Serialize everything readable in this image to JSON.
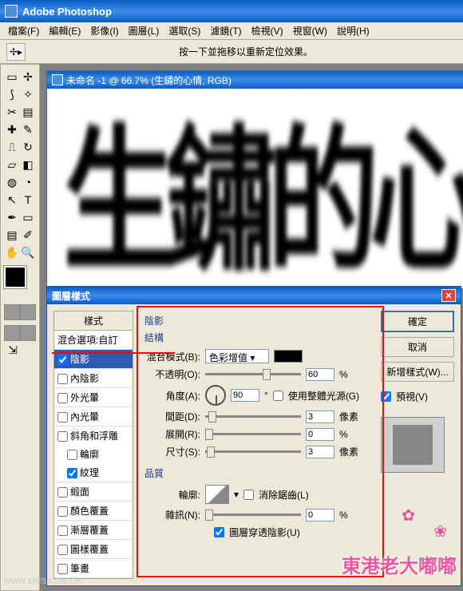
{
  "app": {
    "title": "Adobe Photoshop"
  },
  "menu": [
    "檔案(F)",
    "編輯(E)",
    "影像(I)",
    "圖層(L)",
    "選取(S)",
    "濾鏡(T)",
    "檢視(V)",
    "視窗(W)",
    "說明(H)"
  ],
  "optbar": {
    "hint": "按一下並拖移以重新定位效果。"
  },
  "doc": {
    "title": "未命名 -1 @ 66.7% (生鏽的心情, RGB)"
  },
  "canvas_text": "生鏽的心情",
  "dialog": {
    "title": "圖層樣式",
    "styles_header": "樣式",
    "blend_opts": "混合選項:自訂",
    "list": [
      {
        "label": "陰影",
        "checked": true,
        "selected": true
      },
      {
        "label": "內陰影",
        "checked": false
      },
      {
        "label": "外光暈",
        "checked": false
      },
      {
        "label": "內光暈",
        "checked": false
      },
      {
        "label": "斜角和浮雕",
        "checked": false
      },
      {
        "label": "輪廓",
        "checked": false,
        "indent": true
      },
      {
        "label": "紋理",
        "checked": true,
        "indent": true
      },
      {
        "label": "緞面",
        "checked": false
      },
      {
        "label": "顏色覆蓋",
        "checked": false
      },
      {
        "label": "漸層覆蓋",
        "checked": false
      },
      {
        "label": "圖樣覆蓋",
        "checked": false
      },
      {
        "label": "筆畫",
        "checked": false
      }
    ],
    "section": "陰影",
    "group_struct": "結構",
    "blend_label": "混合模式(B):",
    "blend_value": "色彩增值",
    "opacity_label": "不透明(O):",
    "opacity_value": "60",
    "angle_label": "角度(A):",
    "angle_value": "90",
    "angle_unit": "°",
    "global_light": "使用整體光源(G)",
    "distance_label": "間距(D):",
    "distance_value": "3",
    "spread_label": "展開(R):",
    "spread_value": "0",
    "size_label": "尺寸(S):",
    "size_value": "3",
    "px": "像素",
    "pct": "%",
    "group_quality": "品質",
    "contour_label": "輪廓:",
    "antialias": "消除鋸齒(L)",
    "noise_label": "雜訊(N):",
    "noise_value": "0",
    "knockout": "圖層穿透陰影(U)",
    "ok": "確定",
    "cancel": "取消",
    "new_style": "新增樣式(W)...",
    "preview": "預視(V)"
  },
  "watermark": "東港老大嘟嘟",
  "wm_url": "WWW.16FS.COM.CN"
}
